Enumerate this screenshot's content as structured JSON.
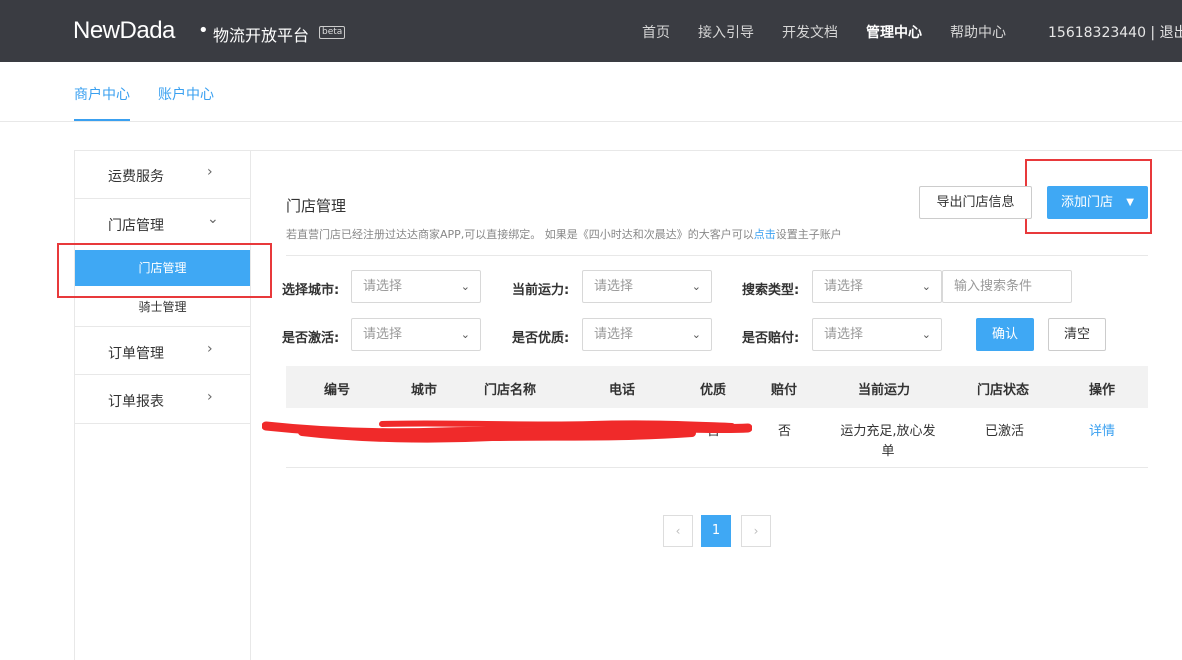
{
  "header": {
    "logo_text": "NewDada",
    "logo_dot": "•",
    "platform": "物流开放平台",
    "beta": "beta",
    "nav": [
      "首页",
      "接入引导",
      "开发文档",
      "管理中心",
      "帮助中心"
    ],
    "user": "15618323440 | 退出"
  },
  "subnav": {
    "tabs": [
      "商户中心",
      "账户中心"
    ]
  },
  "sidebar": {
    "items": [
      {
        "label": "运费服务",
        "chevron": "›"
      },
      {
        "label": "门店管理",
        "chevron": "⌄"
      },
      {
        "label": "订单管理",
        "chevron": "›"
      },
      {
        "label": "订单报表",
        "chevron": "›"
      }
    ],
    "sub_items": [
      "门店管理",
      "骑士管理"
    ]
  },
  "main": {
    "title": "门店管理",
    "desc_before": "若直营门店已经注册过达达商家APP,可以直接绑定。 如果是《四小时达和次晨达》的大客户可以",
    "desc_link": "点击",
    "desc_after": "设置主子账户",
    "export_button": "导出门店信息",
    "add_button": "添加门店",
    "add_caret": "▼"
  },
  "filters": {
    "city_label": "选择城市:",
    "capacity_label": "当前运力:",
    "search_type_label": "搜索类型:",
    "activated_label": "是否激活:",
    "quality_label": "是否优质:",
    "compensation_label": "是否赔付:",
    "select_placeholder": "请选择",
    "search_placeholder": "输入搜索条件",
    "confirm_button": "确认",
    "clear_button": "清空",
    "dropdown_glyph": "⌄"
  },
  "table": {
    "columns": [
      "编号",
      "城市",
      "门店名称",
      "电话",
      "优质",
      "赔付",
      "当前运力",
      "门店状态",
      "操作"
    ],
    "rows": [
      {
        "quality": "否",
        "compensation": "否",
        "capacity_line1": "运力充足,放心发",
        "capacity_line2": "单",
        "status": "已激活",
        "action": "详情"
      }
    ]
  },
  "pagination": {
    "prev": "‹",
    "current": "1",
    "next": "›"
  },
  "colors": {
    "topbar": "#3a3c42",
    "accent": "#3fa8f4",
    "annotation": "#e8393b",
    "redaction": "#f02a2a"
  }
}
